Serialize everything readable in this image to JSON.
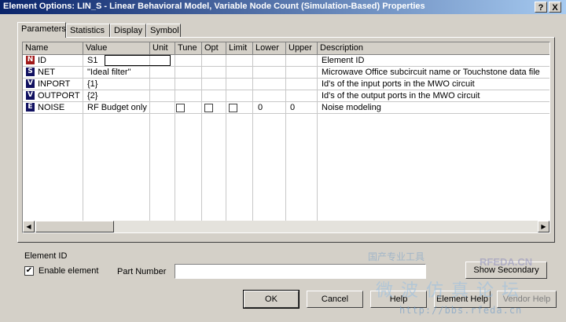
{
  "window": {
    "title": "Element Options: LIN_S - Linear Behavioral Model, Variable Node Count (Simulation-Based) Properties",
    "help_btn": "?",
    "close_btn": "X"
  },
  "tabs": [
    "Parameters",
    "Statistics",
    "Display",
    "Symbol"
  ],
  "table": {
    "headers": [
      "Name",
      "Value",
      "Unit",
      "Tune",
      "Opt",
      "Limit",
      "Lower",
      "Upper",
      "Description"
    ],
    "rows": [
      {
        "badge": "N",
        "badge_color": "#a01818",
        "name": "ID",
        "value": "S1",
        "desc": "Element ID"
      },
      {
        "badge": "S",
        "badge_color": "#101060",
        "name": "NET",
        "value": "\"Ideal filter\"",
        "desc": "Microwave Office subcircuit name or Touchstone data file"
      },
      {
        "badge": "V",
        "badge_color": "#101060",
        "name": "INPORT",
        "value": "{1}",
        "desc": "Id's of the input ports in the MWO circuit"
      },
      {
        "badge": "V",
        "badge_color": "#101060",
        "name": "OUTPORT",
        "value": "{2}",
        "desc": "Id's of the output ports in the MWO circuit"
      },
      {
        "badge": "E",
        "badge_color": "#101060",
        "name": "NOISE",
        "value": "RF Budget only",
        "lower": "0",
        "upper": "0",
        "desc": "Noise modeling"
      }
    ]
  },
  "footer": {
    "element_label": "Element ID",
    "enable_label": "Enable element",
    "enable_checked": "✔",
    "part_number_label": "Part Number",
    "part_number_value": ""
  },
  "buttons": {
    "show_secondary": "Show Secondary",
    "ok": "OK",
    "cancel": "Cancel",
    "help": "Help",
    "element_help": "Element Help",
    "vendor_help": "Vendor Help"
  },
  "watermark": {
    "line1": "微波仿真论坛",
    "line2": "http://bbs.rfeda.cn",
    "line3": "RFEDA.CN",
    "line4": "国产专业工具"
  }
}
